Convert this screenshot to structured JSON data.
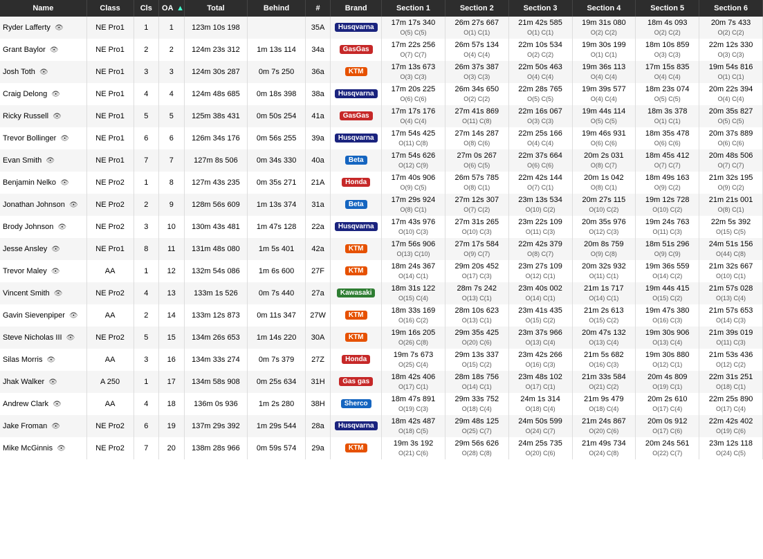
{
  "table": {
    "headers": [
      {
        "label": "Name",
        "key": "name",
        "sortable": true,
        "arrow": ""
      },
      {
        "label": "Class",
        "key": "class",
        "sortable": true,
        "arrow": ""
      },
      {
        "label": "Cls",
        "key": "cls",
        "sortable": true,
        "arrow": ""
      },
      {
        "label": "OA",
        "key": "oa",
        "sortable": true,
        "arrow": "▲"
      },
      {
        "label": "Total",
        "key": "total",
        "sortable": true,
        "arrow": ""
      },
      {
        "label": "Behind",
        "key": "behind",
        "sortable": true,
        "arrow": ""
      },
      {
        "label": "#",
        "key": "hash",
        "sortable": true,
        "arrow": ""
      },
      {
        "label": "Brand",
        "key": "brand",
        "sortable": true,
        "arrow": ""
      },
      {
        "label": "Section 1",
        "key": "s1",
        "sortable": true,
        "arrow": ""
      },
      {
        "label": "Section 2",
        "key": "s2",
        "sortable": true,
        "arrow": ""
      },
      {
        "label": "Section 3",
        "key": "s3",
        "sortable": true,
        "arrow": ""
      },
      {
        "label": "Section 4",
        "key": "s4",
        "sortable": true,
        "arrow": ""
      },
      {
        "label": "Section 5",
        "key": "s5",
        "sortable": true,
        "arrow": ""
      },
      {
        "label": "Section 6",
        "key": "s6",
        "sortable": true,
        "arrow": ""
      }
    ],
    "rows": [
      {
        "name": "Ryder Lafferty",
        "class": "NE Pro1",
        "cls": "1",
        "oa": "1",
        "total": "123m 10s 198",
        "behind": "",
        "hash": "35A",
        "brand": "Husqvarna",
        "brand_class": "brand-husqvarna",
        "s1": "17m 17s 340",
        "s1s": "O(5) C(5)",
        "s2": "26m 27s 667",
        "s2s": "O(1) C(1)",
        "s3": "21m 42s 585",
        "s3s": "O(1) C(1)",
        "s4": "19m 31s 080",
        "s4s": "O(2) C(2)",
        "s5": "18m 4s 093",
        "s5s": "O(2) C(2)",
        "s6": "20m 7s 433",
        "s6s": "O(2) C(2)"
      },
      {
        "name": "Grant Baylor",
        "class": "NE Pro1",
        "cls": "2",
        "oa": "2",
        "total": "124m 23s 312",
        "behind": "1m 13s 114",
        "hash": "34a",
        "brand": "GasGas",
        "brand_class": "brand-gasgas",
        "s1": "17m 22s 256",
        "s1s": "O(7) C(7)",
        "s2": "26m 57s 134",
        "s2s": "O(4) C(4)",
        "s3": "22m 10s 534",
        "s3s": "O(2) C(2)",
        "s4": "19m 30s 199",
        "s4s": "O(1) C(1)",
        "s5": "18m 10s 859",
        "s5s": "O(3) C(3)",
        "s6": "22m 12s 330",
        "s6s": "O(3) C(3)"
      },
      {
        "name": "Josh Toth",
        "class": "NE Pro1",
        "cls": "3",
        "oa": "3",
        "total": "124m 30s 287",
        "behind": "0m 7s 250",
        "hash": "36a",
        "brand": "KTM",
        "brand_class": "brand-ktm",
        "s1": "17m 13s 673",
        "s1s": "O(3) C(3)",
        "s2": "26m 37s 387",
        "s2s": "O(3) C(3)",
        "s3": "22m 50s 463",
        "s3s": "O(4) C(4)",
        "s4": "19m 36s 113",
        "s4s": "O(4) C(4)",
        "s5": "17m 15s 835",
        "s5s": "O(4) C(4)",
        "s6": "19m 54s 816",
        "s6s": "O(1) C(1)"
      },
      {
        "name": "Craig Delong",
        "class": "NE Pro1",
        "cls": "4",
        "oa": "4",
        "total": "124m 48s 685",
        "behind": "0m 18s 398",
        "hash": "38a",
        "brand": "Husqvarna",
        "brand_class": "brand-husqvarna",
        "s1": "17m 20s 225",
        "s1s": "O(6) C(6)",
        "s2": "26m 34s 650",
        "s2s": "O(2) C(2)",
        "s3": "22m 28s 765",
        "s3s": "O(5) C(5)",
        "s4": "19m 39s 577",
        "s4s": "O(4) C(4)",
        "s5": "18m 23s 074",
        "s5s": "O(5) C(5)",
        "s6": "20m 22s 394",
        "s6s": "O(4) C(4)"
      },
      {
        "name": "Ricky Russell",
        "class": "NE Pro1",
        "cls": "5",
        "oa": "5",
        "total": "125m 38s 431",
        "behind": "0m 50s 254",
        "hash": "41a",
        "brand": "GasGas",
        "brand_class": "brand-gasgas",
        "s1": "17m 17s 176",
        "s1s": "O(4) C(4)",
        "s2": "27m 41s 869",
        "s2s": "O(11) C(8)",
        "s3": "22m 16s 067",
        "s3s": "O(3) C(3)",
        "s4": "19m 44s 114",
        "s4s": "O(5) C(5)",
        "s5": "18m 3s 378",
        "s5s": "O(1) C(1)",
        "s6": "20m 35s 827",
        "s6s": "O(5) C(5)"
      },
      {
        "name": "Trevor Bollinger",
        "class": "NE Pro1",
        "cls": "6",
        "oa": "6",
        "total": "126m 34s 176",
        "behind": "0m 56s 255",
        "hash": "39a",
        "brand": "Husqvarna",
        "brand_class": "brand-husqvarna",
        "s1": "17m 54s 425",
        "s1s": "O(11) C(8)",
        "s2": "27m 14s 287",
        "s2s": "O(8) C(6)",
        "s3": "22m 25s 166",
        "s3s": "O(4) C(4)",
        "s4": "19m 46s 931",
        "s4s": "O(6) C(6)",
        "s5": "18m 35s 478",
        "s5s": "O(6) C(6)",
        "s6": "20m 37s 889",
        "s6s": "O(6) C(6)"
      },
      {
        "name": "Evan Smith",
        "class": "NE Pro1",
        "cls": "7",
        "oa": "7",
        "total": "127m 8s 506",
        "behind": "0m 34s 330",
        "hash": "40a",
        "brand": "Beta",
        "brand_class": "brand-beta",
        "s1": "17m 54s 626",
        "s1s": "O(12) C(9)",
        "s2": "27m 0s 267",
        "s2s": "O(6) C(5)",
        "s3": "22m 37s 664",
        "s3s": "O(6) C(6)",
        "s4": "20m 2s 031",
        "s4s": "O(8) C(7)",
        "s5": "18m 45s 412",
        "s5s": "O(7) C(7)",
        "s6": "20m 48s 506",
        "s6s": "O(7) C(7)"
      },
      {
        "name": "Benjamin Nelko",
        "class": "NE Pro2",
        "cls": "1",
        "oa": "8",
        "total": "127m 43s 235",
        "behind": "0m 35s 271",
        "hash": "21A",
        "brand": "Honda",
        "brand_class": "brand-honda",
        "s1": "17m 40s 906",
        "s1s": "O(9) C(5)",
        "s2": "26m 57s 785",
        "s2s": "O(8) C(1)",
        "s3": "22m 42s 144",
        "s3s": "O(7) C(1)",
        "s4": "20m 1s 042",
        "s4s": "O(8) C(1)",
        "s5": "18m 49s 163",
        "s5s": "O(9) C(2)",
        "s6": "21m 32s 195",
        "s6s": "O(9) C(2)"
      },
      {
        "name": "Jonathan Johnson",
        "class": "NE Pro2",
        "cls": "2",
        "oa": "9",
        "total": "128m 56s 609",
        "behind": "1m 13s 374",
        "hash": "31a",
        "brand": "Beta",
        "brand_class": "brand-beta",
        "s1": "17m 29s 924",
        "s1s": "O(8) C(1)",
        "s2": "27m 12s 307",
        "s2s": "O(7) C(2)",
        "s3": "23m 13s 534",
        "s3s": "O(10) C(2)",
        "s4": "20m 27s 115",
        "s4s": "O(10) C(2)",
        "s5": "19m 12s 728",
        "s5s": "O(10) C(2)",
        "s6": "21m 21s 001",
        "s6s": "O(8) C(1)"
      },
      {
        "name": "Brody Johnson",
        "class": "NE Pro2",
        "cls": "3",
        "oa": "10",
        "total": "130m 43s 481",
        "behind": "1m 47s 128",
        "hash": "22a",
        "brand": "Husqvarna",
        "brand_class": "brand-husqvarna",
        "s1": "17m 43s 976",
        "s1s": "O(10) C(3)",
        "s2": "27m 31s 265",
        "s2s": "O(10) C(3)",
        "s3": "23m 22s 109",
        "s3s": "O(11) C(3)",
        "s4": "20m 35s 976",
        "s4s": "O(12) C(3)",
        "s5": "19m 24s 763",
        "s5s": "O(11) C(3)",
        "s6": "22m 5s 392",
        "s6s": "O(15) C(5)"
      },
      {
        "name": "Jesse Ansley",
        "class": "NE Pro1",
        "cls": "8",
        "oa": "11",
        "total": "131m 48s 080",
        "behind": "1m 5s 401",
        "hash": "42a",
        "brand": "KTM",
        "brand_class": "brand-ktm",
        "s1": "17m 56s 906",
        "s1s": "O(13) C(10)",
        "s2": "27m 17s 584",
        "s2s": "O(9) C(7)",
        "s3": "22m 42s 379",
        "s3s": "O(8) C(7)",
        "s4": "20m 8s 759",
        "s4s": "O(9) C(8)",
        "s5": "18m 51s 296",
        "s5s": "O(9) C(9)",
        "s6": "24m 51s 156",
        "s6s": "O(44) C(8)"
      },
      {
        "name": "Trevor Maley",
        "class": "AA",
        "cls": "1",
        "oa": "12",
        "total": "132m 54s 086",
        "behind": "1m 6s 600",
        "hash": "27F",
        "brand": "KTM",
        "brand_class": "brand-ktm",
        "s1": "18m 24s 367",
        "s1s": "O(14) C(1)",
        "s2": "29m 20s 452",
        "s2s": "O(17) C(3)",
        "s3": "23m 27s 109",
        "s3s": "O(12) C(1)",
        "s4": "20m 32s 932",
        "s4s": "O(11) C(1)",
        "s5": "19m 36s 559",
        "s5s": "O(14) C(2)",
        "s6": "21m 32s 667",
        "s6s": "O(10) C(1)"
      },
      {
        "name": "Vincent Smith",
        "class": "NE Pro2",
        "cls": "4",
        "oa": "13",
        "total": "133m 1s 526",
        "behind": "0m 7s 440",
        "hash": "27a",
        "brand": "Kawasaki",
        "brand_class": "brand-kawasaki",
        "s1": "18m 31s 122",
        "s1s": "O(15) C(4)",
        "s2": "28m 7s 242",
        "s2s": "O(13) C(1)",
        "s3": "23m 40s 002",
        "s3s": "O(14) C(1)",
        "s4": "21m 1s 717",
        "s4s": "O(14) C(1)",
        "s5": "19m 44s 415",
        "s5s": "O(15) C(2)",
        "s6": "21m 57s 028",
        "s6s": "O(13) C(4)"
      },
      {
        "name": "Gavin Sievenpiper",
        "class": "AA",
        "cls": "2",
        "oa": "14",
        "total": "133m 12s 873",
        "behind": "0m 11s 347",
        "hash": "27W",
        "brand": "KTM",
        "brand_class": "brand-ktm",
        "s1": "18m 33s 169",
        "s1s": "O(16) C(2)",
        "s2": "28m 10s 623",
        "s2s": "O(13) C(1)",
        "s3": "23m 41s 435",
        "s3s": "O(15) C(2)",
        "s4": "21m 2s 613",
        "s4s": "O(15) C(2)",
        "s5": "19m 47s 380",
        "s5s": "O(16) C(3)",
        "s6": "21m 57s 653",
        "s6s": "O(14) C(3)"
      },
      {
        "name": "Steve Nicholas III",
        "class": "NE Pro2",
        "cls": "5",
        "oa": "15",
        "total": "134m 26s 653",
        "behind": "1m 14s 220",
        "hash": "30A",
        "brand": "KTM",
        "brand_class": "brand-ktm",
        "s1": "19m 16s 205",
        "s1s": "O(26) C(8)",
        "s2": "29m 35s 425",
        "s2s": "O(20) C(6)",
        "s3": "23m 37s 966",
        "s3s": "O(13) C(4)",
        "s4": "20m 47s 132",
        "s4s": "O(13) C(4)",
        "s5": "19m 30s 906",
        "s5s": "O(13) C(4)",
        "s6": "21m 39s 019",
        "s6s": "O(11) C(3)"
      },
      {
        "name": "Silas Morris",
        "class": "AA",
        "cls": "3",
        "oa": "16",
        "total": "134m 33s 274",
        "behind": "0m 7s 379",
        "hash": "27Z",
        "brand": "Honda",
        "brand_class": "brand-honda",
        "s1": "19m 7s 673",
        "s1s": "O(25) C(4)",
        "s2": "29m 13s 337",
        "s2s": "O(15) C(2)",
        "s3": "23m 42s 266",
        "s3s": "O(16) C(3)",
        "s4": "21m 5s 682",
        "s4s": "O(16) C(3)",
        "s5": "19m 30s 880",
        "s5s": "O(12) C(1)",
        "s6": "21m 53s 436",
        "s6s": "O(12) C(2)"
      },
      {
        "name": "Jhak Walker",
        "class": "A 250",
        "cls": "1",
        "oa": "17",
        "total": "134m 58s 908",
        "behind": "0m 25s 634",
        "hash": "31H",
        "brand": "Gas gas",
        "brand_class": "brand-gasgas",
        "s1": "18m 42s 406",
        "s1s": "O(17) C(1)",
        "s2": "28m 18s 756",
        "s2s": "O(14) C(1)",
        "s3": "23m 48s 102",
        "s3s": "O(17) C(1)",
        "s4": "21m 33s 584",
        "s4s": "O(21) C(2)",
        "s5": "20m 4s 809",
        "s5s": "O(19) C(1)",
        "s6": "22m 31s 251",
        "s6s": "O(18) C(1)"
      },
      {
        "name": "Andrew Clark",
        "class": "AA",
        "cls": "4",
        "oa": "18",
        "total": "136m 0s 936",
        "behind": "1m 2s 280",
        "hash": "38H",
        "brand": "Sherco",
        "brand_class": "brand-sherco",
        "s1": "18m 47s 891",
        "s1s": "O(19) C(3)",
        "s2": "29m 33s 752",
        "s2s": "O(18) C(4)",
        "s3": "24m 1s 314",
        "s3s": "O(18) C(4)",
        "s4": "21m 9s 479",
        "s4s": "O(18) C(4)",
        "s5": "20m 2s 610",
        "s5s": "O(17) C(4)",
        "s6": "22m 25s 890",
        "s6s": "O(17) C(4)"
      },
      {
        "name": "Jake Froman",
        "class": "NE Pro2",
        "cls": "6",
        "oa": "19",
        "total": "137m 29s 392",
        "behind": "1m 29s 544",
        "hash": "28a",
        "brand": "Husqvarna",
        "brand_class": "brand-husqvarna",
        "s1": "18m 42s 487",
        "s1s": "O(18) C(5)",
        "s2": "29m 48s 125",
        "s2s": "O(25) C(7)",
        "s3": "24m 50s 599",
        "s3s": "O(24) C(7)",
        "s4": "21m 24s 867",
        "s4s": "O(20) C(6)",
        "s5": "20m 0s 912",
        "s5s": "O(17) C(6)",
        "s6": "22m 42s 402",
        "s6s": "O(19) C(6)"
      },
      {
        "name": "Mike McGinnis",
        "class": "NE Pro2",
        "cls": "7",
        "oa": "20",
        "total": "138m 28s 966",
        "behind": "0m 59s 574",
        "hash": "29a",
        "brand": "KTM",
        "brand_class": "brand-ktm",
        "s1": "19m 3s 192",
        "s1s": "O(21) C(6)",
        "s2": "29m 56s 626",
        "s2s": "O(28) C(8)",
        "s3": "24m 25s 735",
        "s3s": "O(20) C(6)",
        "s4": "21m 49s 734",
        "s4s": "O(24) C(8)",
        "s5": "20m 24s 561",
        "s5s": "O(22) C(7)",
        "s6": "23m 12s 118",
        "s6s": "O(24) C(5)"
      }
    ]
  }
}
